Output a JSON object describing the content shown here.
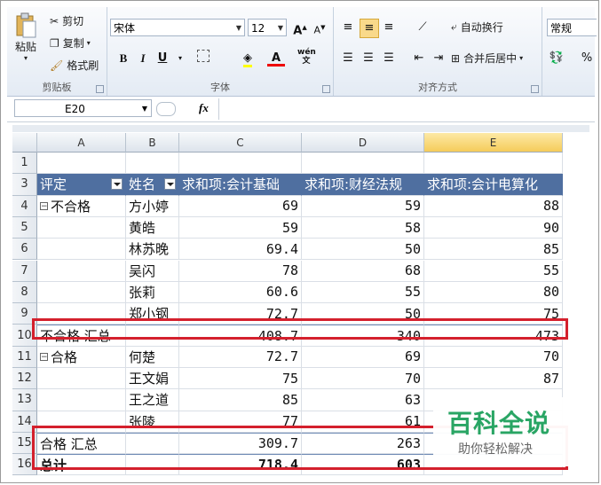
{
  "ribbon": {
    "clipboard": {
      "paste": "粘贴",
      "cut": "剪切",
      "copy": "复制",
      "format_painter": "格式刷",
      "group": "剪贴板"
    },
    "font": {
      "name": "宋体",
      "size": "12",
      "bold": "B",
      "italic": "I",
      "underline": "U",
      "color_letter": "A",
      "group": "字体",
      "phonetic": "wén"
    },
    "alignment": {
      "wrap_text": "自动换行",
      "merge_center": "合并后居中",
      "group": "对齐方式"
    },
    "number": {
      "format": "常规",
      "percent": "%"
    }
  },
  "formula_bar": {
    "name_box": "E20",
    "fx": "fx",
    "value": ""
  },
  "columns": [
    "A",
    "B",
    "C",
    "D",
    "E"
  ],
  "pivot": {
    "headers": [
      "评定",
      "姓名",
      "求和项:会计基础",
      "求和项:财经法规",
      "求和项:会计电算化"
    ],
    "rows": [
      {
        "num": "1",
        "a": "",
        "b": "",
        "c": "",
        "d": "",
        "e": ""
      },
      {
        "num": "3",
        "header": true
      },
      {
        "num": "4",
        "a": "不合格",
        "minus": true,
        "b": "方小婷",
        "c": "69",
        "d": "59",
        "e": "88"
      },
      {
        "num": "5",
        "a": "",
        "b": "黄皓",
        "c": "59",
        "d": "58",
        "e": "90"
      },
      {
        "num": "6",
        "a": "",
        "b": "林苏晚",
        "c": "69.4",
        "d": "50",
        "e": "85"
      },
      {
        "num": "7",
        "a": "",
        "b": "吴闪",
        "c": "78",
        "d": "68",
        "e": "55"
      },
      {
        "num": "8",
        "a": "",
        "b": "张莉",
        "c": "60.6",
        "d": "55",
        "e": "80"
      },
      {
        "num": "9",
        "a": "",
        "b": "郑小钢",
        "c": "72.7",
        "d": "50",
        "e": "75"
      },
      {
        "num": "10",
        "a": "不合格 汇总",
        "b": "",
        "c": "408.7",
        "d": "340",
        "e": "473",
        "subtotal": true
      },
      {
        "num": "11",
        "a": "合格",
        "minus": true,
        "b": "何楚",
        "c": "72.7",
        "d": "69",
        "e": "70"
      },
      {
        "num": "12",
        "a": "",
        "b": "王文娟",
        "c": "75",
        "d": "70",
        "e": "87"
      },
      {
        "num": "13",
        "a": "",
        "b": "王之道",
        "c": "85",
        "d": "63",
        "e": ""
      },
      {
        "num": "14",
        "a": "",
        "b": "张陵",
        "c": "77",
        "d": "61",
        "e": ""
      },
      {
        "num": "15",
        "a": "合格 汇总",
        "b": "",
        "c": "309.7",
        "d": "263",
        "e": "",
        "subtotal": true
      },
      {
        "num": "16",
        "a": "总计",
        "b": "",
        "c": "718.4",
        "d": "603",
        "e": "",
        "total": true
      }
    ]
  },
  "watermark": {
    "title": "百科全说",
    "subtitle": "助你轻松解决"
  },
  "colors": {
    "header_fill": "#4f6fa0",
    "highlight_box": "#d4202d",
    "watermark_green": "#29a564"
  }
}
